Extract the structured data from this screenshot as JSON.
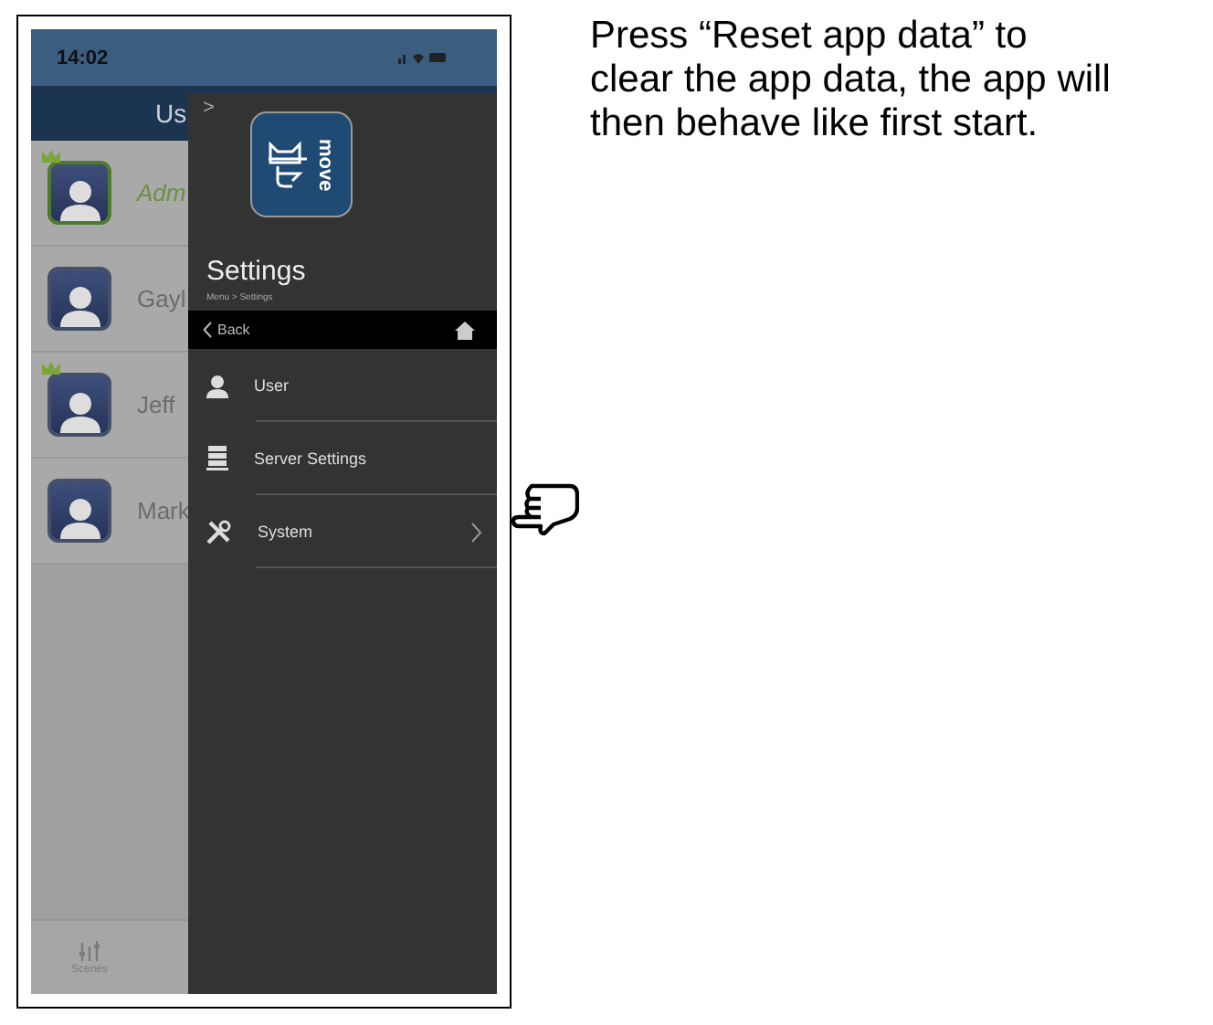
{
  "phone": {
    "status_bar": {
      "time": "14:02"
    },
    "user_list": {
      "title": "Us",
      "users": [
        {
          "name": "Adm",
          "selected": true,
          "crown": true
        },
        {
          "name": "Gayl",
          "selected": false,
          "crown": false
        },
        {
          "name": "Jeff",
          "selected": false,
          "crown": true
        },
        {
          "name": "Mark",
          "selected": false,
          "crown": false
        }
      ],
      "tab_bar": [
        {
          "label": "Scenes"
        }
      ]
    },
    "drawer": {
      "collapse": ">",
      "logo_text": "move",
      "title": "Settings",
      "breadcrumb": "Menu > Settings",
      "back": "Back",
      "items": [
        {
          "kind": "user",
          "label": "User",
          "chevron": false
        },
        {
          "kind": "server",
          "label": "Server Settings",
          "chevron": false
        },
        {
          "kind": "tools",
          "label": "System",
          "chevron": true
        }
      ]
    }
  },
  "instruction": "Press “Reset app data” to clear the app data, the app will then behave like first start."
}
